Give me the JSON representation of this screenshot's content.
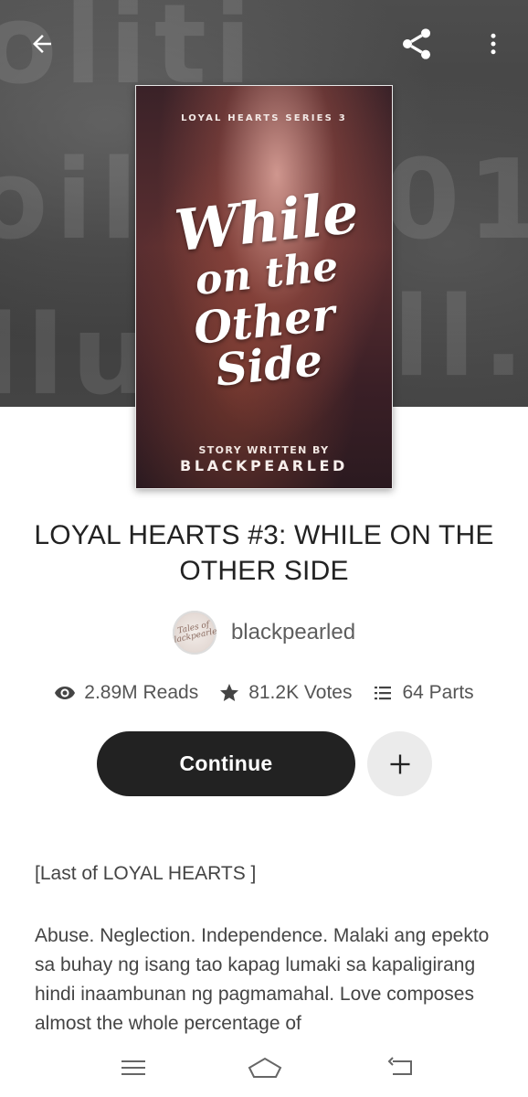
{
  "cover": {
    "series": "LOYAL HEARTS SERIES 3",
    "title_line1": "While",
    "title_line2": "on the",
    "title_line3": "Other Side",
    "written_by": "STORY WRITTEN BY",
    "author": "BLACKPEARLED"
  },
  "story": {
    "title": "LOYAL HEARTS #3: WHILE ON THE OTHER SIDE",
    "author": "blackpearled",
    "avatar_text": "Tales of Blackpearled"
  },
  "stats": {
    "reads": "2.89M Reads",
    "votes": "81.2K Votes",
    "parts": "64 Parts"
  },
  "actions": {
    "continue_label": "Continue"
  },
  "description": {
    "heading": "[Last of LOYAL HEARTS ]",
    "body": "Abuse. Neglection. Independence. Malaki ang epekto sa buhay ng isang tao kapag lumaki sa kapaligirang hindi inaambunan ng pagmamahal. Love composes almost the whole percentage of"
  },
  "icons": {
    "back": "arrow-left-icon",
    "share": "share-icon",
    "more": "more-vertical-icon",
    "reads": "eye-icon",
    "votes": "star-icon",
    "parts": "list-icon",
    "add": "plus-icon"
  },
  "colors": {
    "primary_button": "#222222",
    "secondary_button": "#ebebeb",
    "text_muted": "#555555"
  }
}
